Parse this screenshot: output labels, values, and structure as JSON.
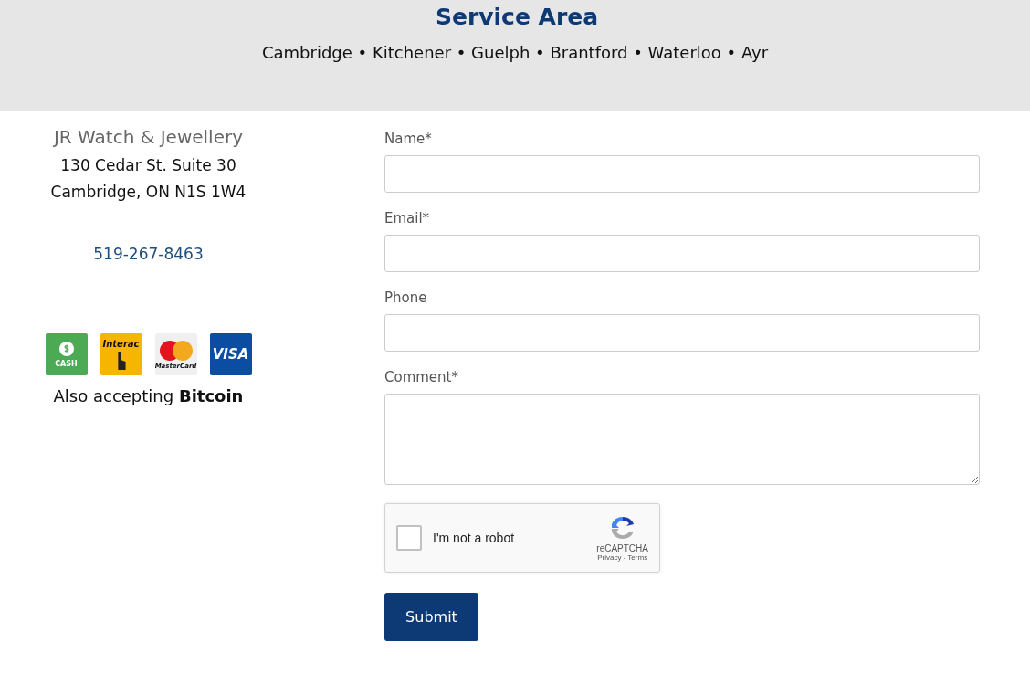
{
  "header": {
    "title": "Service Area",
    "cities": "Cambridge • Kitchener • Guelph • Brantford • Waterloo • Ayr"
  },
  "business": {
    "name": "JR Watch & Jewellery",
    "address_line_1": "130 Cedar St. Suite 30",
    "address_line_2": "Cambridge, ON N1S 1W4",
    "phone": "519-267-8463"
  },
  "payments": [
    {
      "kind": "cash",
      "label": "CASH"
    },
    {
      "kind": "interac",
      "label": "Interac"
    },
    {
      "kind": "mastercard",
      "label": "MasterCard"
    },
    {
      "kind": "visa",
      "label": "VISA"
    }
  ],
  "payment_note": "Also accepting **Bitcoin**",
  "form": {
    "fields": [
      {
        "label": "Name*",
        "kind": "text"
      },
      {
        "label": "Email*",
        "kind": "text"
      },
      {
        "label": "Phone",
        "kind": "text"
      },
      {
        "label": "Comment*",
        "kind": "textarea"
      }
    ],
    "captcha": {
      "label": "I'm not a robot",
      "checked": false,
      "brand": "reCAPTCHA",
      "links": "Privacy - Terms"
    },
    "submit": "Submit"
  }
}
